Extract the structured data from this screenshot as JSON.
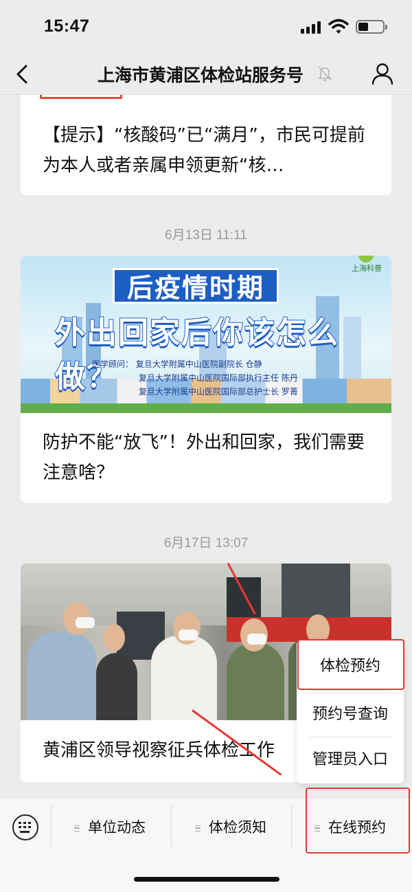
{
  "status_bar": {
    "time": "15:47"
  },
  "nav": {
    "title": "上海市黄浦区体检站服务号",
    "icons": [
      "back-arrow-icon",
      "mute-bell-icon",
      "user-profile-icon"
    ]
  },
  "feed": [
    {
      "text": "【提示】“核酸码”已“满月”，市民可提前为本人或者亲属申领更新“核…"
    },
    {
      "timestamp": "6月13日 11:11",
      "banner": {
        "brand": "上海科普",
        "title1": "后疫情时期",
        "title2": "外出回家后你该怎么做？",
        "credits": [
          "医学顾问：  复旦大学附属中山医院副院长    仓静",
          "复旦大学附属中山医院国际部执行主任    陈丹",
          "复旦大学附属中山医院国际部总护士长    罗菁"
        ]
      },
      "text": "防护不能“放飞”！外出和回家，我们需要注意啥？"
    },
    {
      "timestamp": "6月17日 13:07",
      "text": "黄浦区领导视察征兵体检工作"
    }
  ],
  "popup_menu": {
    "items": [
      "体检预约",
      "预约号查询",
      "管理员入口"
    ]
  },
  "bottom_menu": {
    "keyboard_icon": "keyboard-icon",
    "tabs": [
      "单位动态",
      "体检须知",
      "在线预约"
    ]
  },
  "colors": {
    "background": "#ececec",
    "highlight_red": "#e53935",
    "banner_blue": "#1c5ec2"
  }
}
